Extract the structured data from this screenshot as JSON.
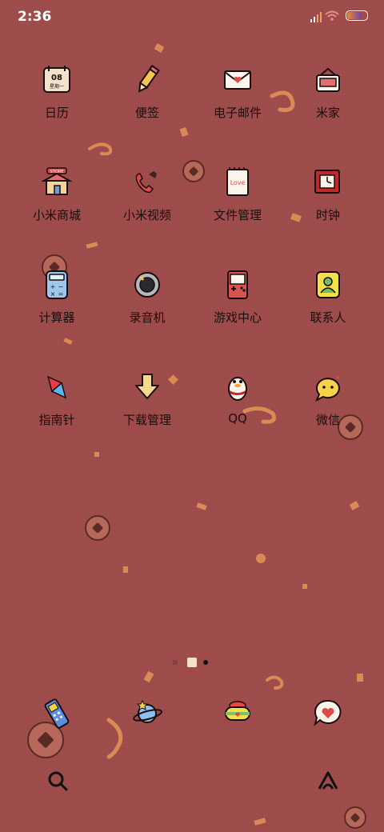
{
  "status": {
    "time": "2:36"
  },
  "apps": [
    {
      "label": "日历",
      "icon": "calendar-icon",
      "calendar_day": "08",
      "calendar_week": "星期一"
    },
    {
      "label": "便签",
      "icon": "pencil-icon"
    },
    {
      "label": "电子邮件",
      "icon": "envelope-icon"
    },
    {
      "label": "米家",
      "icon": "home-device-icon"
    },
    {
      "label": "小米商城",
      "icon": "store-icon",
      "store_sign": "STORE"
    },
    {
      "label": "小米视频",
      "icon": "video-phone-icon"
    },
    {
      "label": "文件管理",
      "icon": "notebook-icon",
      "notebook_text": "Love"
    },
    {
      "label": "时钟",
      "icon": "clock-icon"
    },
    {
      "label": "计算器",
      "icon": "calculator-icon"
    },
    {
      "label": "录音机",
      "icon": "recorder-icon"
    },
    {
      "label": "游戏中心",
      "icon": "gameboy-icon"
    },
    {
      "label": "联系人",
      "icon": "contacts-icon"
    },
    {
      "label": "指南针",
      "icon": "compass-icon"
    },
    {
      "label": "下载管理",
      "icon": "download-arrow-icon"
    },
    {
      "label": "QQ",
      "icon": "penguin-icon"
    },
    {
      "label": "微信",
      "icon": "chat-bubble-icon"
    }
  ],
  "dock": [
    {
      "icon": "phone-icon"
    },
    {
      "icon": "planet-icon"
    },
    {
      "icon": "candy-icon"
    },
    {
      "icon": "heart-message-icon"
    }
  ],
  "bottom": {
    "left_icon": "search-icon",
    "right_icon": "app-drawer-icon"
  },
  "colors": {
    "background": "#9e4b4b",
    "accent": "#d98b55",
    "text": "#1a0d0d"
  }
}
